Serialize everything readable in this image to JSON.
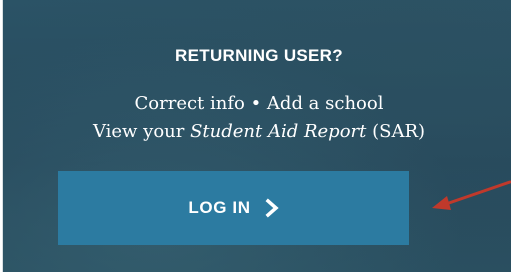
{
  "returning_user": {
    "heading": "RETURNING USER?",
    "line1": "Correct info • Add a school",
    "line2_prefix": "View your ",
    "line2_italic": "Student Aid Report",
    "line2_suffix": " (SAR)"
  },
  "login_button": {
    "label": "LOG IN",
    "icon": "chevron-right-icon"
  },
  "annotation": {
    "icon": "red-arrow-icon",
    "color": "#c0392b"
  },
  "colors": {
    "panel": "#284c5e",
    "button": "#2c7ba1",
    "text": "#ffffff"
  }
}
